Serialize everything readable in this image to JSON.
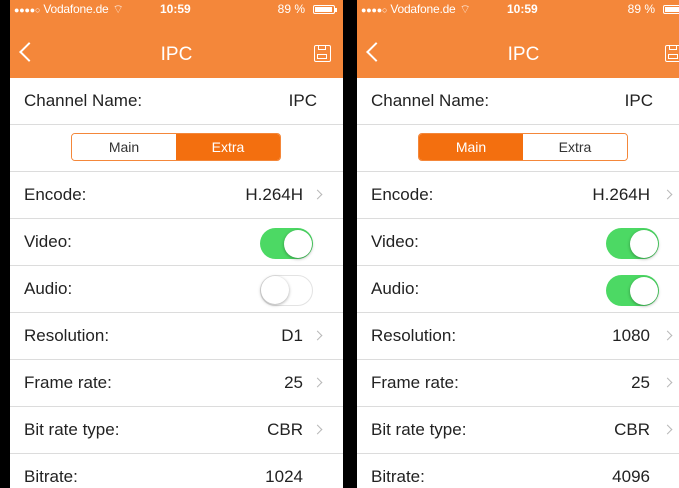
{
  "left": {
    "status": {
      "carrier": "Vodafone.de",
      "time": "10:59",
      "battery": "89 %"
    },
    "title": "IPC",
    "channel_label": "Channel Name:",
    "channel_value": "IPC",
    "segments": [
      "Main",
      "Extra"
    ],
    "active_segment": "Extra",
    "rows": {
      "encode": {
        "label": "Encode:",
        "value": "H.264H"
      },
      "video": {
        "label": "Video:",
        "on": true
      },
      "audio": {
        "label": "Audio:",
        "on": false
      },
      "resolution": {
        "label": "Resolution:",
        "value": "D1"
      },
      "frame_rate": {
        "label": "Frame rate:",
        "value": "25"
      },
      "bit_rate_type": {
        "label": "Bit rate type:",
        "value": "CBR"
      },
      "bitrate": {
        "label": "Bitrate:",
        "value": "1024"
      }
    }
  },
  "right": {
    "status": {
      "carrier": "Vodafone.de",
      "time": "10:59",
      "battery": "89 %"
    },
    "title": "IPC",
    "channel_label": "Channel Name:",
    "channel_value": "IPC",
    "segments": [
      "Main",
      "Extra"
    ],
    "active_segment": "Main",
    "rows": {
      "encode": {
        "label": "Encode:",
        "value": "H.264H"
      },
      "video": {
        "label": "Video:",
        "on": true
      },
      "audio": {
        "label": "Audio:",
        "on": true
      },
      "resolution": {
        "label": "Resolution:",
        "value": "1080"
      },
      "frame_rate": {
        "label": "Frame rate:",
        "value": "25"
      },
      "bit_rate_type": {
        "label": "Bit rate type:",
        "value": "CBR"
      },
      "bitrate": {
        "label": "Bitrate:",
        "value": "4096"
      }
    }
  },
  "colors": {
    "accent": "#f4873a",
    "segment_active": "#f36f0f",
    "toggle_on": "#4cd964"
  },
  "icons": {
    "back": "chevron-left-icon",
    "save": "floppy-disk-icon",
    "disclosure": "chevron-right-icon",
    "wifi": "wifi-icon",
    "battery": "battery-icon"
  }
}
